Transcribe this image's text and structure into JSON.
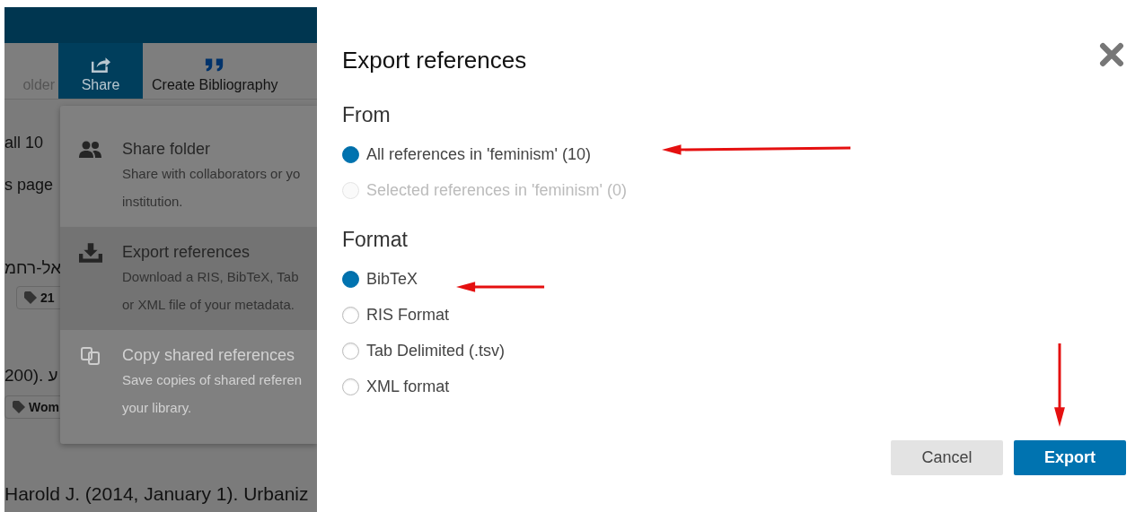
{
  "toolbar": {
    "items": [
      {
        "label": "older",
        "selected": false
      },
      {
        "label": "Share",
        "selected": true
      },
      {
        "label": "Create Bibliography",
        "selected": false
      }
    ]
  },
  "page": {
    "lines": [
      {
        "kind": "text",
        "text": "all 10"
      },
      {
        "kind": "text",
        "text": "s page"
      },
      {
        "kind": "rtl",
        "text": "אל-רחמ"
      },
      {
        "kind": "tags",
        "tags": [
          "21"
        ]
      },
      {
        "kind": "rtl",
        "text": "ע .(200"
      },
      {
        "kind": "tags",
        "tags": [
          "Wom"
        ]
      },
      {
        "kind": "text",
        "text": "Harold J. (2014, January 1). Urbaniz"
      }
    ]
  },
  "share_menu": {
    "items": [
      {
        "title": "Share folder",
        "description": [
          "Share with collaborators or yo",
          "institution."
        ],
        "disabled": false,
        "hovered": false
      },
      {
        "title": "Export references",
        "description": [
          "Download a RIS, BibTeX, Tab",
          "or XML file of your metadata."
        ],
        "disabled": false,
        "hovered": true
      },
      {
        "title": "Copy shared references",
        "description": [
          "Save copies of shared referen",
          "your library."
        ],
        "disabled": true,
        "hovered": false
      }
    ]
  },
  "dialog": {
    "title": "Export references",
    "sections": [
      {
        "heading": "From",
        "options": [
          {
            "label": "All references in 'feminism' (10)",
            "selected": true,
            "disabled": false
          },
          {
            "label": "Selected references in 'feminism' (0)",
            "selected": false,
            "disabled": true
          }
        ]
      },
      {
        "heading": "Format",
        "options": [
          {
            "label": "BibTeX",
            "selected": true,
            "disabled": false
          },
          {
            "label": "RIS Format",
            "selected": false,
            "disabled": false
          },
          {
            "label": "Tab Delimited (.tsv)",
            "selected": false,
            "disabled": false
          },
          {
            "label": "XML format",
            "selected": false,
            "disabled": false
          }
        ]
      }
    ],
    "buttons": [
      {
        "label": "Cancel",
        "kind": "secondary"
      },
      {
        "label": "Export",
        "kind": "primary"
      }
    ]
  }
}
